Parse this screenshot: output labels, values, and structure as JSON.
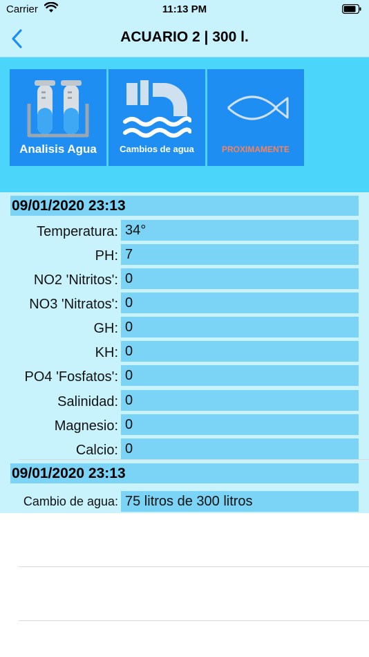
{
  "status_bar": {
    "carrier": "Carrier",
    "time": "11:13 PM"
  },
  "nav": {
    "title": "ACUARIO 2 | 300 l."
  },
  "tiles": [
    {
      "label": "Analisis Agua",
      "icon": "test-tubes-icon",
      "label_color": "#ffffff"
    },
    {
      "label": "Cambios de agua",
      "icon": "water-pipe-icon",
      "label_color": "#ffffff"
    },
    {
      "label": "PROXIMAMENTE",
      "icon": "fish-icon",
      "label_color": "#f0855e"
    }
  ],
  "analysis": {
    "date": "09/01/2020 23:13",
    "rows": [
      {
        "label": "Temperatura:",
        "value": "34°"
      },
      {
        "label": "PH:",
        "value": "7"
      },
      {
        "label": "NO2 'Nitritos':",
        "value": "0"
      },
      {
        "label": "NO3 'Nitratos':",
        "value": "0"
      },
      {
        "label": "GH:",
        "value": "0"
      },
      {
        "label": "KH:",
        "value": "0"
      },
      {
        "label": "PO4 'Fosfatos':",
        "value": "0"
      },
      {
        "label": "Salinidad:",
        "value": "0"
      },
      {
        "label": "Magnesio:",
        "value": "0"
      },
      {
        "label": "Calcio:",
        "value": "0"
      }
    ]
  },
  "water_change": {
    "date": "09/01/2020 23:13",
    "label": "Cambio de agua:",
    "value": "75 litros de 300 litros"
  },
  "colors": {
    "header_bg": "#c8f3fd",
    "tile_bar_bg": "#4cd5fb",
    "tile_bg": "#1f8ef2",
    "cell_bg": "#7bd3f5",
    "accent": "#1f8ef2"
  }
}
